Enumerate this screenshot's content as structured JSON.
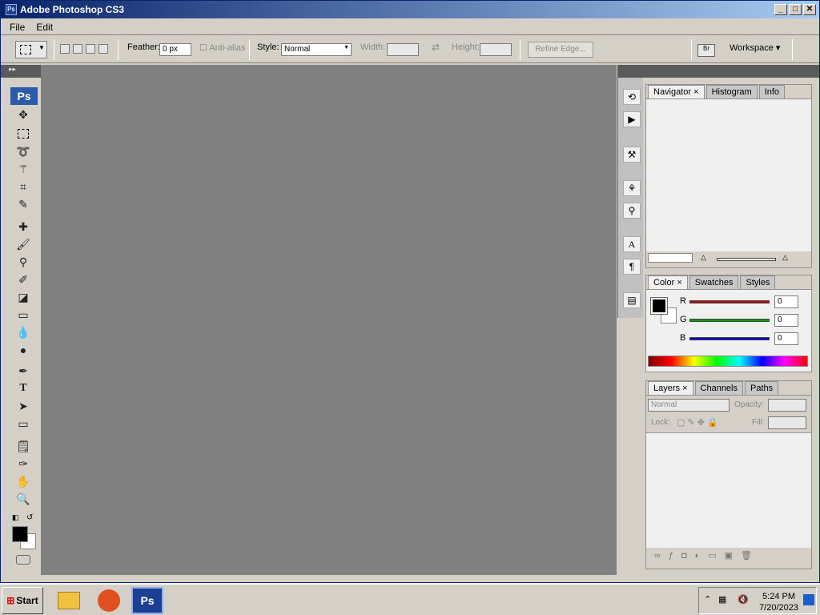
{
  "window": {
    "title": "Adobe Photoshop CS3",
    "app_icon": "Ps"
  },
  "menu": [
    "File",
    "Edit"
  ],
  "options": {
    "feather_label": "Feather:",
    "feather_value": "0 px",
    "antialias_label": "Anti-alias",
    "style_label": "Style:",
    "style_value": "Normal",
    "width_label": "Width:",
    "height_label": "Height:",
    "refine_edge": "Refine Edge...",
    "workspace": "Workspace ▾"
  },
  "toolbox": {
    "logo": "Ps"
  },
  "panels": {
    "group1": {
      "tabs": [
        "Navigator",
        "Histogram",
        "Info"
      ]
    },
    "group2": {
      "tabs": [
        "Color",
        "Swatches",
        "Styles"
      ],
      "channels": [
        {
          "name": "R",
          "value": "0",
          "color": "#c00000"
        },
        {
          "name": "G",
          "value": "0",
          "color": "#00a000"
        },
        {
          "name": "B",
          "value": "0",
          "color": "#0000c0"
        }
      ]
    },
    "group3": {
      "tabs": [
        "Layers",
        "Channels",
        "Paths"
      ],
      "blend": "Normal",
      "opacity_label": "Opacity:",
      "lock_label": "Lock:",
      "fill_label": "Fill:"
    }
  },
  "taskbar": {
    "start": "Start",
    "time": "5:24 PM",
    "date": "7/20/2023"
  }
}
